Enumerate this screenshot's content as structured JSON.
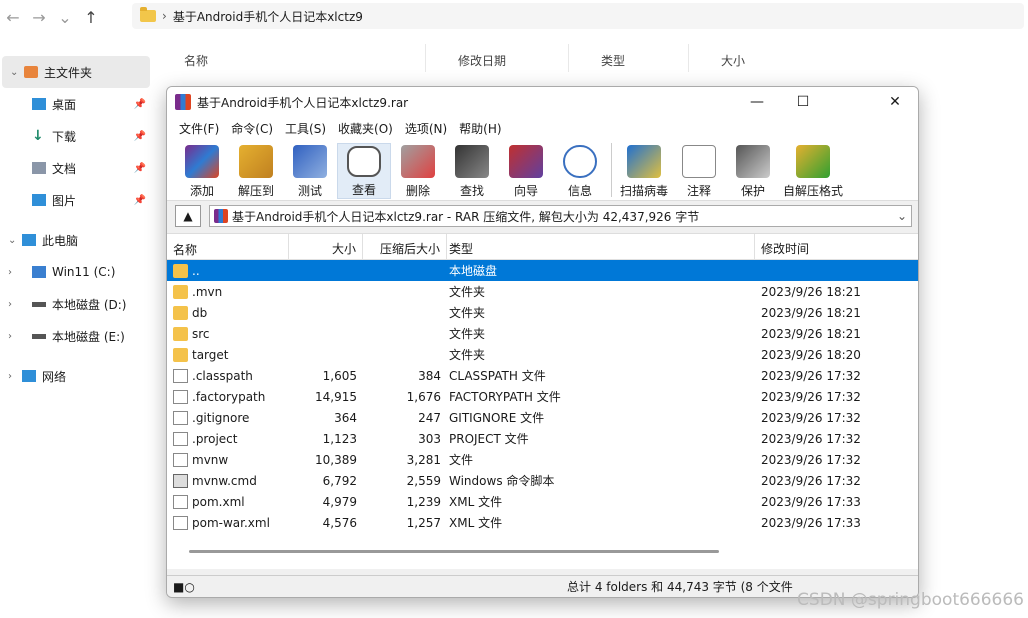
{
  "explorer": {
    "address": "基于Android手机个人日记本xlctz9",
    "columns": [
      "名称",
      "修改日期",
      "类型",
      "大小"
    ],
    "sidebar": [
      {
        "label": "主文件夹"
      },
      {
        "label": "桌面"
      },
      {
        "label": "下载"
      },
      {
        "label": "文档"
      },
      {
        "label": "图片"
      },
      {
        "label": "此电脑"
      },
      {
        "label": "Win11 (C:)"
      },
      {
        "label": "本地磁盘 (D:)"
      },
      {
        "label": "本地磁盘 (E:)"
      },
      {
        "label": "网络"
      }
    ]
  },
  "rar": {
    "title": "基于Android手机个人日记本xlctz9.rar",
    "menu": [
      "文件(F)",
      "命令(C)",
      "工具(S)",
      "收藏夹(O)",
      "选项(N)",
      "帮助(H)"
    ],
    "toolbar": [
      "添加",
      "解压到",
      "测试",
      "查看",
      "删除",
      "查找",
      "向导",
      "信息",
      "扫描病毒",
      "注释",
      "保护",
      "自解压格式"
    ],
    "path": "基于Android手机个人日记本xlctz9.rar - RAR 压缩文件, 解包大小为 42,437,926 字节",
    "headers": [
      "名称",
      "大小",
      "压缩后大小",
      "类型",
      "修改时间"
    ],
    "rows": [
      {
        "name": "..",
        "size": "",
        "packed": "",
        "type": "本地磁盘",
        "modified": "",
        "icon": "folder"
      },
      {
        "name": ".mvn",
        "size": "",
        "packed": "",
        "type": "文件夹",
        "modified": "2023/9/26 18:21",
        "icon": "folder"
      },
      {
        "name": "db",
        "size": "",
        "packed": "",
        "type": "文件夹",
        "modified": "2023/9/26 18:21",
        "icon": "folder"
      },
      {
        "name": "src",
        "size": "",
        "packed": "",
        "type": "文件夹",
        "modified": "2023/9/26 18:21",
        "icon": "folder"
      },
      {
        "name": "target",
        "size": "",
        "packed": "",
        "type": "文件夹",
        "modified": "2023/9/26 18:20",
        "icon": "folder"
      },
      {
        "name": ".classpath",
        "size": "1,605",
        "packed": "384",
        "type": "CLASSPATH 文件",
        "modified": "2023/9/26 17:32",
        "icon": "doc"
      },
      {
        "name": ".factorypath",
        "size": "14,915",
        "packed": "1,676",
        "type": "FACTORYPATH 文件",
        "modified": "2023/9/26 17:32",
        "icon": "doc"
      },
      {
        "name": ".gitignore",
        "size": "364",
        "packed": "247",
        "type": "GITIGNORE 文件",
        "modified": "2023/9/26 17:32",
        "icon": "doc"
      },
      {
        "name": ".project",
        "size": "1,123",
        "packed": "303",
        "type": "PROJECT 文件",
        "modified": "2023/9/26 17:32",
        "icon": "doc"
      },
      {
        "name": "mvnw",
        "size": "10,389",
        "packed": "3,281",
        "type": "文件",
        "modified": "2023/9/26 17:32",
        "icon": "doc"
      },
      {
        "name": "mvnw.cmd",
        "size": "6,792",
        "packed": "2,559",
        "type": "Windows 命令脚本",
        "modified": "2023/9/26 17:32",
        "icon": "cmd"
      },
      {
        "name": "pom.xml",
        "size": "4,979",
        "packed": "1,239",
        "type": "XML 文件",
        "modified": "2023/9/26 17:33",
        "icon": "doc"
      },
      {
        "name": "pom-war.xml",
        "size": "4,576",
        "packed": "1,257",
        "type": "XML 文件",
        "modified": "2023/9/26 17:33",
        "icon": "doc"
      }
    ],
    "status": "总计 4 folders 和 44,743 字节 (8 个文件"
  },
  "watermark": "CSDN @springboot666666"
}
